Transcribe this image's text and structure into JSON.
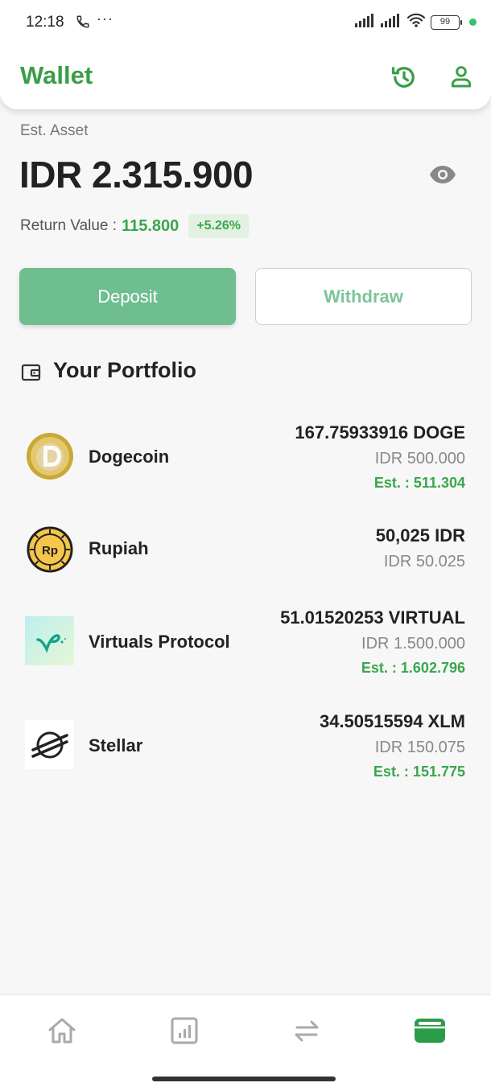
{
  "status_bar": {
    "time": "12:18",
    "dots": "···",
    "battery": "99"
  },
  "header": {
    "title": "Wallet"
  },
  "summary": {
    "est_label": "Est. Asset",
    "balance": "IDR 2.315.900",
    "return_label": "Return Value :",
    "return_value": "115.800",
    "return_pct": "+5.26%"
  },
  "actions": {
    "deposit": "Deposit",
    "withdraw": "Withdraw"
  },
  "portfolio": {
    "title": "Your Portfolio",
    "items": [
      {
        "name": "Dogecoin",
        "amount": "167.75933916 DOGE",
        "idr": "IDR 500.000",
        "est": "Est. : 511.304"
      },
      {
        "name": "Rupiah",
        "amount": "50,025 IDR",
        "idr": "IDR 50.025",
        "est": ""
      },
      {
        "name": "Virtuals Protocol",
        "amount": "51.01520253 VIRTUAL",
        "idr": "IDR 1.500.000",
        "est": "Est. : 1.602.796"
      },
      {
        "name": "Stellar",
        "amount": "34.50515594 XLM",
        "idr": "IDR 150.075",
        "est": "Est. : 151.775"
      }
    ]
  },
  "icons": {
    "header": [
      "history-icon",
      "user-icon"
    ],
    "nav": [
      "home-icon",
      "chart-icon",
      "swap-icon",
      "wallet-icon"
    ]
  },
  "colors": {
    "brand": "#3a9e47",
    "deposit": "#6ebe8f",
    "positive": "#3ba64c"
  }
}
